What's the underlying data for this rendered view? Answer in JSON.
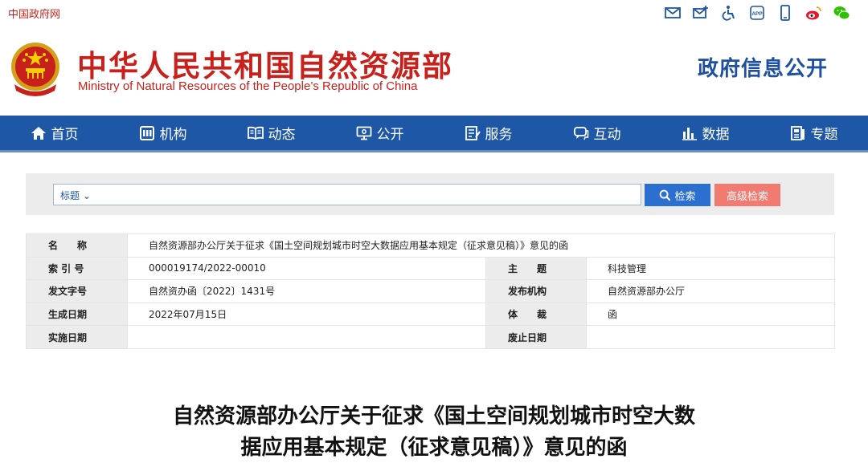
{
  "topbar": {
    "gov_link": "中国政府网",
    "icons": [
      "mail-icon",
      "mail-add-icon",
      "accessibility-icon",
      "app-icon",
      "mobile-icon",
      "weibo-icon",
      "wechat-icon"
    ],
    "app_label": "APP"
  },
  "header": {
    "ministry_cn": "中华人民共和国自然资源部",
    "ministry_en": "Ministry of Natural Resources of the People’s Republic of China",
    "section": "政府信息公开"
  },
  "nav": {
    "items": [
      {
        "label": "首页",
        "icon": "home-icon"
      },
      {
        "label": "机构",
        "icon": "org-icon"
      },
      {
        "label": "动态",
        "icon": "book-icon"
      },
      {
        "label": "公开",
        "icon": "monitor-icon"
      },
      {
        "label": "服务",
        "icon": "doc-edit-icon"
      },
      {
        "label": "互动",
        "icon": "chat-icon"
      },
      {
        "label": "数据",
        "icon": "bar-chart-icon"
      },
      {
        "label": "专题",
        "icon": "topic-icon"
      }
    ]
  },
  "search": {
    "select_value": "标题",
    "placeholder": "",
    "search_label": "检索",
    "advanced_label": "高级检索"
  },
  "info": {
    "name_label": "名　　称",
    "name_value": "自然资源部办公厅关于征求《国土空间规划城市时空大数据应用基本规定（征求意见稿）》意见的函",
    "index_label": "索 引 号",
    "index_value": "000019174/2022-00010",
    "topic_label": "主　　题",
    "topic_value": "科技管理",
    "doc_no_label": "发文字号",
    "doc_no_value": "自然资办函〔2022〕1431号",
    "publisher_label": "发布机构",
    "publisher_value": "自然资源部办公厅",
    "date_label": "生成日期",
    "date_value": "2022年07月15日",
    "genre_label": "体　　裁",
    "genre_value": "函",
    "effective_label": "实施日期",
    "effective_value": "",
    "expire_label": "废止日期",
    "expire_value": ""
  },
  "article": {
    "title_line1": "自然资源部办公厅关于征求《国土空间规划城市时空大数",
    "title_line2": "据应用基本规定（征求意见稿）》意见的函"
  },
  "colors": {
    "brand_red": "#c8201b",
    "nav_blue": "#1e57a6",
    "search_blue": "#2b6fd0",
    "advanced_pink": "#f17a71"
  }
}
